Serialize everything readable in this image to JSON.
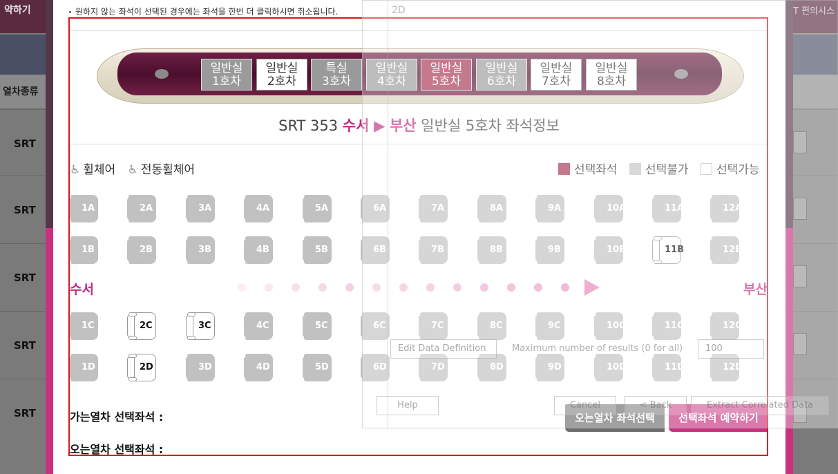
{
  "background": {
    "top_button": "약하기",
    "top_right": "T 편의시스",
    "header_label": "열차종류",
    "header_right": "-",
    "rows": [
      "SRT",
      "SRT",
      "SRT",
      "SRT",
      "SRT"
    ]
  },
  "notice": "원하지 않는 좌석이 선택된 경우에는 좌석을 한번 더 클릭하시면 취소됩니다.",
  "cars": [
    {
      "line1": "일반실",
      "line2": "1호차",
      "state": "gray"
    },
    {
      "line1": "일반실",
      "line2": "2호차",
      "state": "white"
    },
    {
      "line1": "특실",
      "line2": "3호차",
      "state": "gray"
    },
    {
      "line1": "일반실",
      "line2": "4호차",
      "state": "gray"
    },
    {
      "line1": "일반실",
      "line2": "5호차",
      "state": "selected"
    },
    {
      "line1": "일반실",
      "line2": "6호차",
      "state": "gray"
    },
    {
      "line1": "일반실",
      "line2": "7호차",
      "state": "white"
    },
    {
      "line1": "일반실",
      "line2": "8호차",
      "state": "white"
    }
  ],
  "title": {
    "train": "SRT 353",
    "from": "수서",
    "arrow": "▶",
    "to": "부산",
    "rest": "일반실 5호차 좌석정보"
  },
  "legend": {
    "wheelchair": "휠체어",
    "electric_wheelchair": "전동휠체어",
    "selected": "선택좌석",
    "unavailable": "선택불가",
    "available": "선택가능",
    "wheelchair_icon": "♿",
    "electric_icon": "♿",
    "color_selected": "#a8304f",
    "color_unavailable": "#c3c3c3"
  },
  "direction": {
    "from": "수서",
    "to": "부산"
  },
  "seat_rows": [
    {
      "row": "A",
      "available": []
    },
    {
      "row": "B",
      "available": [
        11
      ]
    },
    {
      "row": "C",
      "available": [
        2,
        3
      ]
    },
    {
      "row": "D",
      "available": [
        2
      ]
    }
  ],
  "outbound_label": "가는열차 선택좌석 :",
  "return_label": "오는열차 선택좌석 :",
  "buttons": {
    "return_select": "오는열차 좌석선택",
    "reserve": "선택좌석 예약하기"
  },
  "ghost": {
    "tab": "2D",
    "edit_def": "Edit Data Definition",
    "max_results": "Maximum number of results (0 for all)",
    "max_value": "100",
    "help": "Help",
    "cancel": "Cancel",
    "back": "< Back",
    "extract": "Extract Correlated Data"
  }
}
